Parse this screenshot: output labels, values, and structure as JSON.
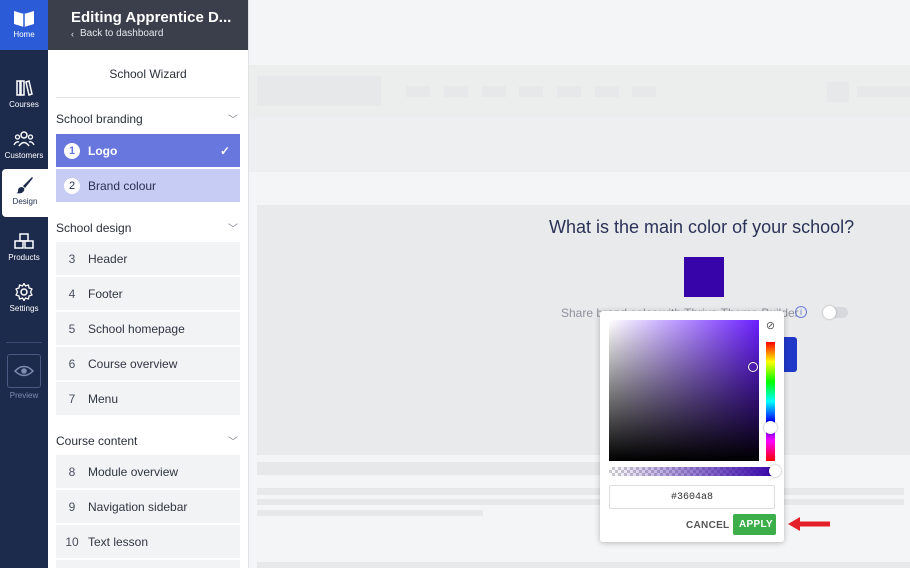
{
  "rail": {
    "home_label": "Home",
    "items": [
      {
        "label": "Courses",
        "icon": "books-icon"
      },
      {
        "label": "Customers",
        "icon": "people-icon"
      },
      {
        "label": "Design",
        "icon": "brush-icon"
      },
      {
        "label": "Products",
        "icon": "boxes-icon"
      },
      {
        "label": "Settings",
        "icon": "gear-icon"
      }
    ],
    "preview_label": "Preview"
  },
  "wizard": {
    "title": "Editing Apprentice D...",
    "back_label": "Back to dashboard",
    "subtitle": "School Wizard",
    "sections": [
      {
        "label": "School branding",
        "steps": [
          {
            "num": "1",
            "label": "Logo"
          },
          {
            "num": "2",
            "label": "Brand colour"
          }
        ]
      },
      {
        "label": "School design",
        "steps": [
          {
            "num": "3",
            "label": "Header"
          },
          {
            "num": "4",
            "label": "Footer"
          },
          {
            "num": "5",
            "label": "School homepage"
          },
          {
            "num": "6",
            "label": "Course overview"
          },
          {
            "num": "7",
            "label": "Menu"
          }
        ]
      },
      {
        "label": "Course content",
        "steps": [
          {
            "num": "8",
            "label": "Module overview"
          },
          {
            "num": "9",
            "label": "Navigation sidebar"
          },
          {
            "num": "10",
            "label": "Text lesson"
          }
        ]
      }
    ]
  },
  "main": {
    "question": "What is the main color of your school?",
    "share_text": "Share brand color with Thrive Theme Builder",
    "selected_color": "#3604a8"
  },
  "picker": {
    "hex_value": "#3604a8",
    "cancel_label": "CANCEL",
    "apply_label": "APPLY"
  },
  "colors": {
    "rail_bg": "#1c2a4c",
    "home_bg": "#2b5bd7",
    "active_step": "#6877de",
    "next_step": "#c7ccf4",
    "apply_green": "#3cae4a",
    "annotation_arrow": "#e3202a"
  }
}
